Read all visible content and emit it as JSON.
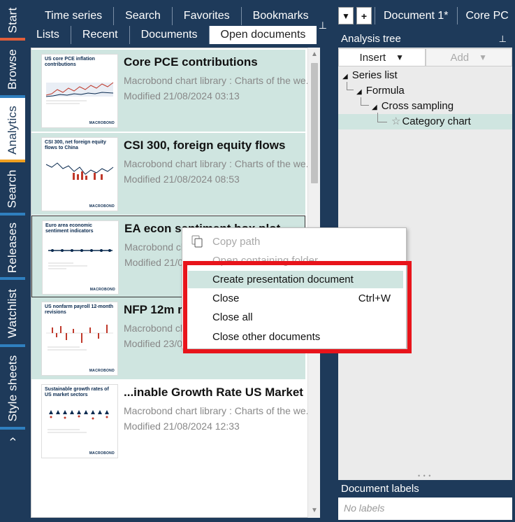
{
  "left_tabs": [
    {
      "label": "Start",
      "underline": "#e15e3a"
    },
    {
      "label": "Browse",
      "underline": "#2f7fbf"
    },
    {
      "label": "Analytics",
      "underline": "#f0a020",
      "active": true
    },
    {
      "label": "Search",
      "underline": "#2f7fbf"
    },
    {
      "label": "Releases",
      "underline": "#2f7fbf"
    },
    {
      "label": "Watchlist",
      "underline": "#2f7fbf"
    },
    {
      "label": "Style sheets",
      "underline": "#2f7fbf"
    },
    {
      "label": "›",
      "underline": ""
    }
  ],
  "top_tabs": {
    "row1": [
      "Time series",
      "Search",
      "Favorites",
      "Bookmarks"
    ],
    "row2": [
      "Lists",
      "Recent",
      "Documents",
      "Open documents"
    ],
    "selected": "Open documents"
  },
  "documents": [
    {
      "title": "Core PCE contributions",
      "library": "Macrobond chart library : Charts of the we...",
      "modified": "Modified  21/08/2024 03:13",
      "thumb_title": "US core PCE inflation contributions",
      "thumb_color": "#c0392b"
    },
    {
      "title": "CSI 300, foreign equity flows",
      "library": "Macrobond chart library : Charts of the we...",
      "modified": "Modified  21/08/2024 08:53",
      "thumb_title": "CSI 300, net foreign equity flows to China",
      "thumb_color": "#c0392b"
    },
    {
      "title": "EA econ sentiment box plot",
      "library": "Macrobond chart library : Charts of the we...",
      "modified": "Modified  21/08/2024 ...",
      "thumb_title": "Euro area economic sentiment indicators",
      "thumb_color": "#0a2a4f"
    },
    {
      "title": "NFP 12m revisions",
      "library": "Macrobond chart library : Charts of the we...",
      "modified": "Modified  23/08/2024 ...",
      "thumb_title": "US nonfarm payroll 12-month revisions",
      "thumb_color": "#c0392b"
    },
    {
      "title": "...inable Growth Rate US Market",
      "library": "Macrobond chart library : Charts of the we...",
      "modified": "Modified  21/08/2024 12:33",
      "thumb_title": "Sustainable growth rates of US market sectors",
      "thumb_color": "#0a2a4f"
    }
  ],
  "thumb_logo": "MACROBOND",
  "document_tabs": {
    "dropdown_icon": "caret-down-icon",
    "add_icon": "plus-icon",
    "tabs": [
      "Document 1*",
      "Core PC"
    ]
  },
  "analysis_tree": {
    "header": "Analysis tree",
    "insert_label": "Insert",
    "add_label": "Add",
    "nodes": [
      "Series list",
      "Formula",
      "Cross sampling",
      "Category chart"
    ],
    "selected": "Category chart"
  },
  "document_labels": {
    "header": "Document labels",
    "placeholder": "No labels"
  },
  "context_menu": {
    "items": [
      {
        "label": "Copy path",
        "disabled": true,
        "icon": "copy-icon"
      },
      {
        "label": "Open containing folder",
        "disabled": true
      },
      {
        "label": "Create presentation document",
        "hover": true
      },
      {
        "label": "Close",
        "shortcut": "Ctrl+W"
      },
      {
        "label": "Close all"
      },
      {
        "label": "Close other documents"
      }
    ],
    "highlight_box_color": "#e8141b"
  },
  "colors": {
    "navy": "#1e3a5a",
    "highlight": "#cfe5e0"
  }
}
